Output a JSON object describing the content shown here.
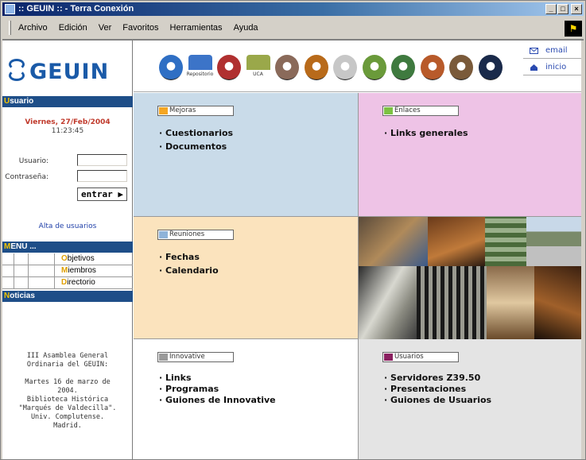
{
  "window": {
    "title": ":: GEUIN :: - Terra Conexión",
    "controls": {
      "minimize": "_",
      "maximize": "□",
      "close": "×"
    }
  },
  "menubar": {
    "items": [
      "Archivo",
      "Edición",
      "Ver",
      "Favoritos",
      "Herramientas",
      "Ayuda"
    ]
  },
  "sidebar": {
    "logo_text": "GEUIN",
    "usuario_header": {
      "first": "U",
      "rest": "suario"
    },
    "date": "Viernes, 27/Feb/2004",
    "time": "11:23:45",
    "login": {
      "user_label": "Usuario:",
      "password_label": "Contraseña:",
      "user_value": "",
      "password_value": "",
      "submit_label": "entrar ▶"
    },
    "signup_link": "Alta de usuarios",
    "menu_header": {
      "first": "M",
      "rest": "ENU ..."
    },
    "menu_items": [
      {
        "first": "O",
        "rest": "bjetivos"
      },
      {
        "first": "M",
        "rest": "iembros"
      },
      {
        "first": "D",
        "rest": "irectorio"
      }
    ],
    "news_header": {
      "first": "N",
      "rest": "oticias"
    },
    "news_text": [
      "III Asamblea General",
      "Ordinaria del GEUIN:",
      "",
      "Martes 16 de marzo de",
      "2004.",
      "Biblioteca Histórica",
      "\"Marqués de Valdecilla\".",
      "Univ. Complutense.",
      "Madrid."
    ]
  },
  "banner": {
    "emblems": [
      {
        "name": "emblem-1-icon",
        "color": "#2f6fc4"
      },
      {
        "name": "emblem-repositorio-icon",
        "color": "#3c74c8",
        "caption": "Repositorio"
      },
      {
        "name": "emblem-shield-icon",
        "color": "#b03030"
      },
      {
        "name": "emblem-uca-icon",
        "color": "#9aa84a",
        "caption": "UCA"
      },
      {
        "name": "emblem-4-icon",
        "color": "#8a6a5a"
      },
      {
        "name": "emblem-5-icon",
        "color": "#b86a1a"
      },
      {
        "name": "emblem-6-icon",
        "color": "#c7c7c7"
      },
      {
        "name": "emblem-7-icon",
        "color": "#6a9a3a"
      },
      {
        "name": "emblem-8-icon",
        "color": "#3f7a3f"
      },
      {
        "name": "emblem-9-icon",
        "color": "#b85a2a"
      },
      {
        "name": "emblem-10-icon",
        "color": "#7a5a3a"
      },
      {
        "name": "emblem-11-icon",
        "color": "#1a2a4a"
      }
    ],
    "email_label": "email",
    "home_label": "inicio"
  },
  "quadrants": {
    "mejoras": {
      "label": "Mejoras",
      "swatch": "#f5a623",
      "bg": "#c9dbe9",
      "items": [
        "Cuestionarios",
        "Documentos"
      ]
    },
    "enlaces": {
      "label": "Enlaces",
      "swatch": "#7cc242",
      "bg": "#eec3e6",
      "items": [
        "Links generales"
      ]
    },
    "reuniones": {
      "label": "Reuniones",
      "swatch": "#8fb3d9",
      "bg": "#fbe3bd",
      "items": [
        "Fechas",
        "Calendario"
      ]
    },
    "innovative": {
      "label": "Innovative",
      "swatch": "#9a9a9a",
      "bg": "#ffffff",
      "items": [
        "Links",
        "Programas",
        "Guiones de Innovative"
      ]
    },
    "usuarios": {
      "label": "Usuarios",
      "swatch": "#8a2060",
      "bg": "#e4e4e4",
      "items": [
        "Servidores Z39.50",
        "Presentaciones",
        "Guiones de Usuarios"
      ]
    }
  },
  "colors": {
    "header_blue": "#1e4e88",
    "header_first_letter": "#f2c300",
    "link_blue": "#1f3fa8",
    "date_red": "#c0392b"
  }
}
